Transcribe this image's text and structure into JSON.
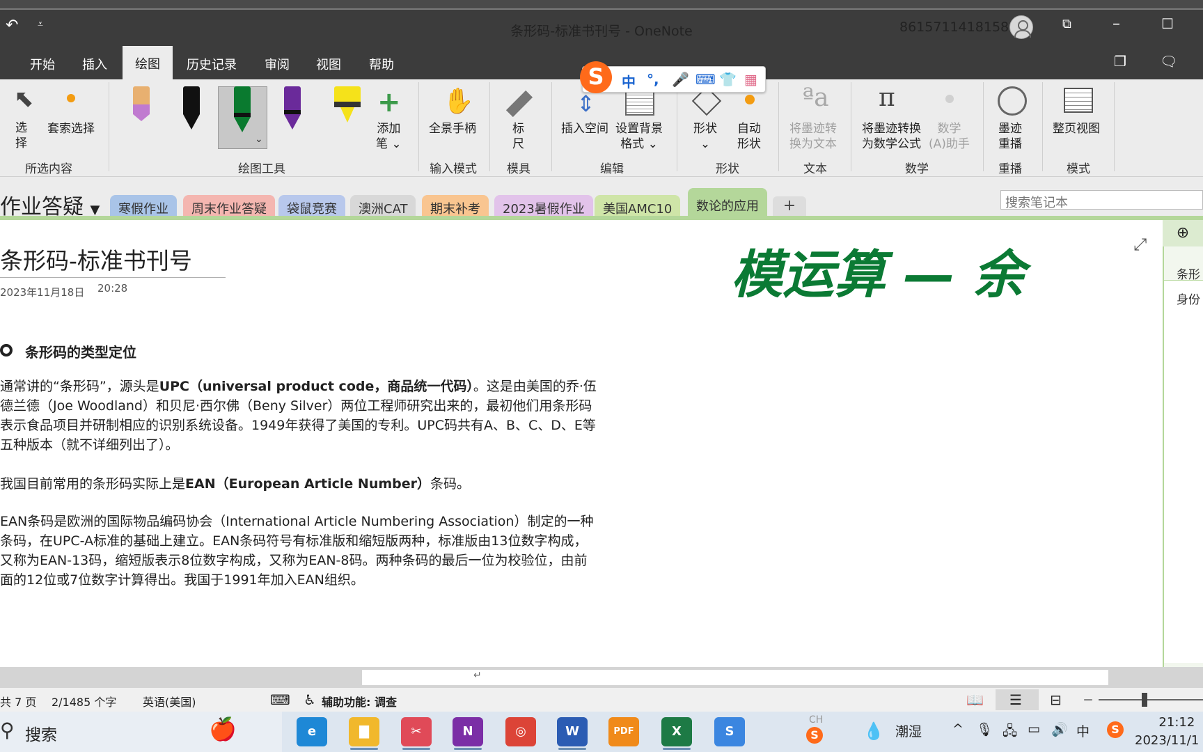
{
  "window": {
    "title": "条形码-标准书刊号  -  OneNote",
    "account": "8615711418158"
  },
  "menu": {
    "items": [
      "开始",
      "插入",
      "绘图",
      "历史记录",
      "审阅",
      "视图",
      "帮助"
    ],
    "active": "绘图"
  },
  "ribbon": {
    "select": "选\n择",
    "lasso": "套索选择",
    "group_selection": "所选内容",
    "add_pen": "添加\n笔 ⌄",
    "group_tools": "绘图工具",
    "pan": "全景手柄",
    "group_input": "输入模式",
    "ruler": "标\n尺",
    "group_ruler": "模具",
    "insert_space": "插入空间",
    "background": "设置背景\n格式 ⌄",
    "group_edit": "编辑",
    "shapes": "形状\n⌄",
    "auto_shapes": "自动\n形状",
    "group_shapes": "形状",
    "ink_to_text": "将墨迹转\n换为文本",
    "group_text": "文本",
    "ink_to_math": "将墨迹转换\n为数学公式",
    "math_assistant": "数学\n(A)助手",
    "group_math": "数学",
    "ink_replay": "墨迹\n重播",
    "group_replay": "重播",
    "full_page": "整页视图",
    "group_mode": "模式",
    "pen_colors": [
      "#e8b070",
      "#111111",
      "#0a7a2f",
      "#6a2a9a",
      "#f5e21a"
    ]
  },
  "ime": {
    "logo": "S",
    "items": [
      "中",
      "°,",
      "🎤",
      "⌨",
      "👕",
      "▦"
    ]
  },
  "notebook": {
    "name": "作业答疑",
    "sections": [
      {
        "label": "寒假作业",
        "color": "#a9c4e8"
      },
      {
        "label": "周末作业答疑",
        "color": "#f4b6b0"
      },
      {
        "label": "袋鼠竞赛",
        "color": "#b8c8ec"
      },
      {
        "label": "澳洲CAT",
        "color": "#d8d8d8"
      },
      {
        "label": "期末补考",
        "color": "#f9c590"
      },
      {
        "label": "2023暑假作业",
        "color": "#e2c3ea"
      },
      {
        "label": "美国AMC10",
        "color": "#cfe5a8"
      },
      {
        "label": "数论的应用",
        "color": "#b4d79a"
      }
    ],
    "active_section": "数论的应用",
    "search_placeholder": "搜索笔记本"
  },
  "page": {
    "title": "条形码-标准书刊号",
    "date": "2023年11月18日",
    "time": "20:28",
    "handwriting": "模运算 — 余",
    "section_heading": "条形码的类型定位",
    "p1": [
      {
        "t": "通常讲的“条形码”，源头是"
      },
      {
        "t": "UPC（universal product code，商品统一代码）",
        "b": true
      },
      {
        "t": "。这是由美国的乔·伍德兰德（Joe Woodland）和贝尼·西尔佛（Beny Silver）两位工程师研究出来的，最初他们用条形码表示食品项目并研制相应的识别系统设备。1949年获得了美国的专利。UPC码共有A、B、C、D、E等五种版本（就不详细列出了）。"
      }
    ],
    "p2": [
      {
        "t": "我国目前常用的条形码实际上是"
      },
      {
        "t": "EAN（European Article Number）",
        "b": true
      },
      {
        "t": "条码。"
      }
    ],
    "p3": [
      {
        "t": "EAN条码是欧洲的国际物品编码协会（International Article Numbering Association）制定的一种条码，在UPC-A标准的基础上建立。EAN条码符号有标准版和缩短版两种，标准版由13位数字构成，又称为EAN-13码，缩短版表示8位数字构成，又称为EAN-8码。两种条码的最后一位为校验位，由前面的12位或7位数字计算得出。我国于1991年加入EAN组织。"
      }
    ]
  },
  "page_list": {
    "items": [
      "条形",
      "身份"
    ]
  },
  "scroll": {
    "marker": "↵"
  },
  "status": {
    "pages": "共 7 页",
    "words": "2/1485 个字",
    "language": "英语(美国)",
    "accessibility": "辅助功能: 调查",
    "zoom_minus": "－"
  },
  "taskbar": {
    "search": "搜索",
    "weather": "潮湿",
    "ime_lang": "中",
    "ch": "CH",
    "time": "21:12",
    "date": "2023/11/1",
    "apps": [
      {
        "name": "edge",
        "label": "e",
        "color": "#1e88d6"
      },
      {
        "name": "explorer",
        "label": "▇",
        "color": "#f1b82c"
      },
      {
        "name": "snipping",
        "label": "✂",
        "color": "#e04a58"
      },
      {
        "name": "onenote",
        "label": "N",
        "color": "#7b2ea6"
      },
      {
        "name": "chrome",
        "label": "◎",
        "color": "#dc4437"
      },
      {
        "name": "word",
        "label": "W",
        "color": "#2b5cb3"
      },
      {
        "name": "pdf",
        "label": "PDF",
        "color": "#f08a1a"
      },
      {
        "name": "excel",
        "label": "X",
        "color": "#1d7a45"
      },
      {
        "name": "sogou",
        "label": "S",
        "color": "#3b86e0"
      }
    ]
  }
}
